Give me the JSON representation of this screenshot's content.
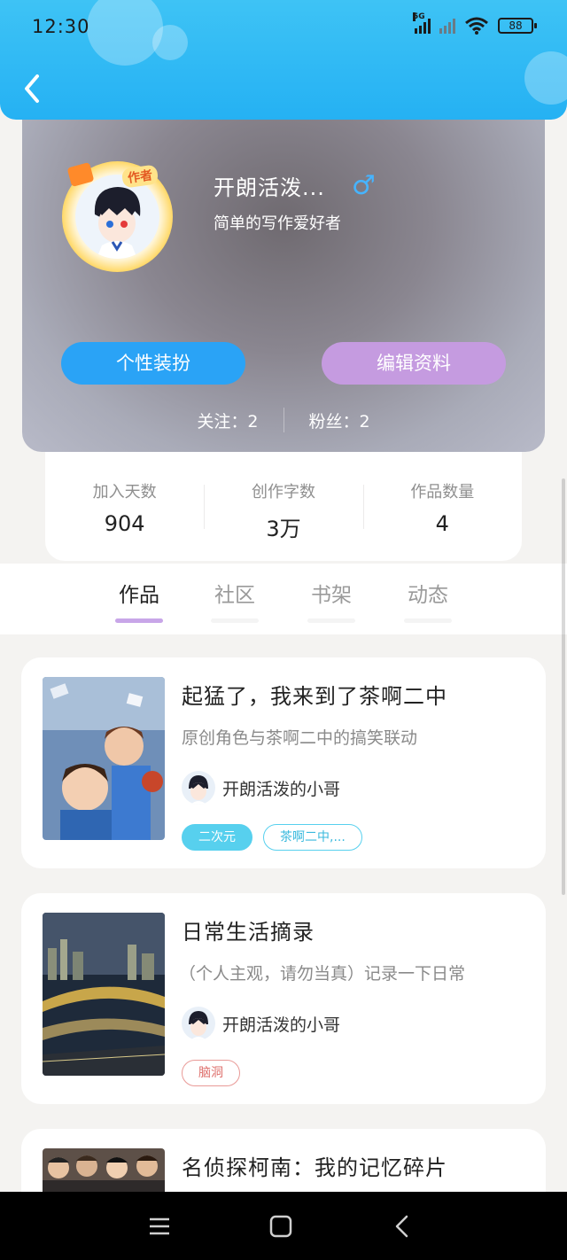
{
  "status_bar": {
    "time": "12:30",
    "network": "5G",
    "wifi_sub": "6",
    "battery": "88"
  },
  "profile": {
    "name": "开朗活泼...",
    "gender_symbol": "♂",
    "bio": "简单的写作爱好者",
    "author_badge": "作者",
    "buttons": {
      "dress_up": "个性装扮",
      "edit_profile": "编辑资料"
    },
    "following": "关注：2",
    "followers": "粉丝：2"
  },
  "stats": [
    {
      "label": "加入天数",
      "value": "904"
    },
    {
      "label": "创作字数",
      "value": "3万"
    },
    {
      "label": "作品数量",
      "value": "4"
    }
  ],
  "tabs": [
    "作品",
    "社区",
    "书架",
    "动态"
  ],
  "active_tab": "作品",
  "works": [
    {
      "title": "起猛了，我来到了茶啊二中",
      "desc": "原创角色与茶啊二中的搞笑联动",
      "author": "开朗活泼的小哥",
      "tags": [
        "二次元",
        "茶啊二中,..."
      ]
    },
    {
      "title": "日常生活摘录",
      "desc": "（个人主观，请勿当真）记录一下日常",
      "author": "开朗活泼的小哥",
      "tags": [
        "脑洞"
      ]
    },
    {
      "title": "名侦探柯南：我的记忆碎片"
    }
  ],
  "colors": {
    "header": "#25b1f3",
    "dress_button": "#2aa3f6",
    "edit_button": "#c59be0",
    "tab_indicator": "#c8a6e8",
    "tag_cyan": "#57d0ee",
    "tag_red": "#e99a97"
  }
}
